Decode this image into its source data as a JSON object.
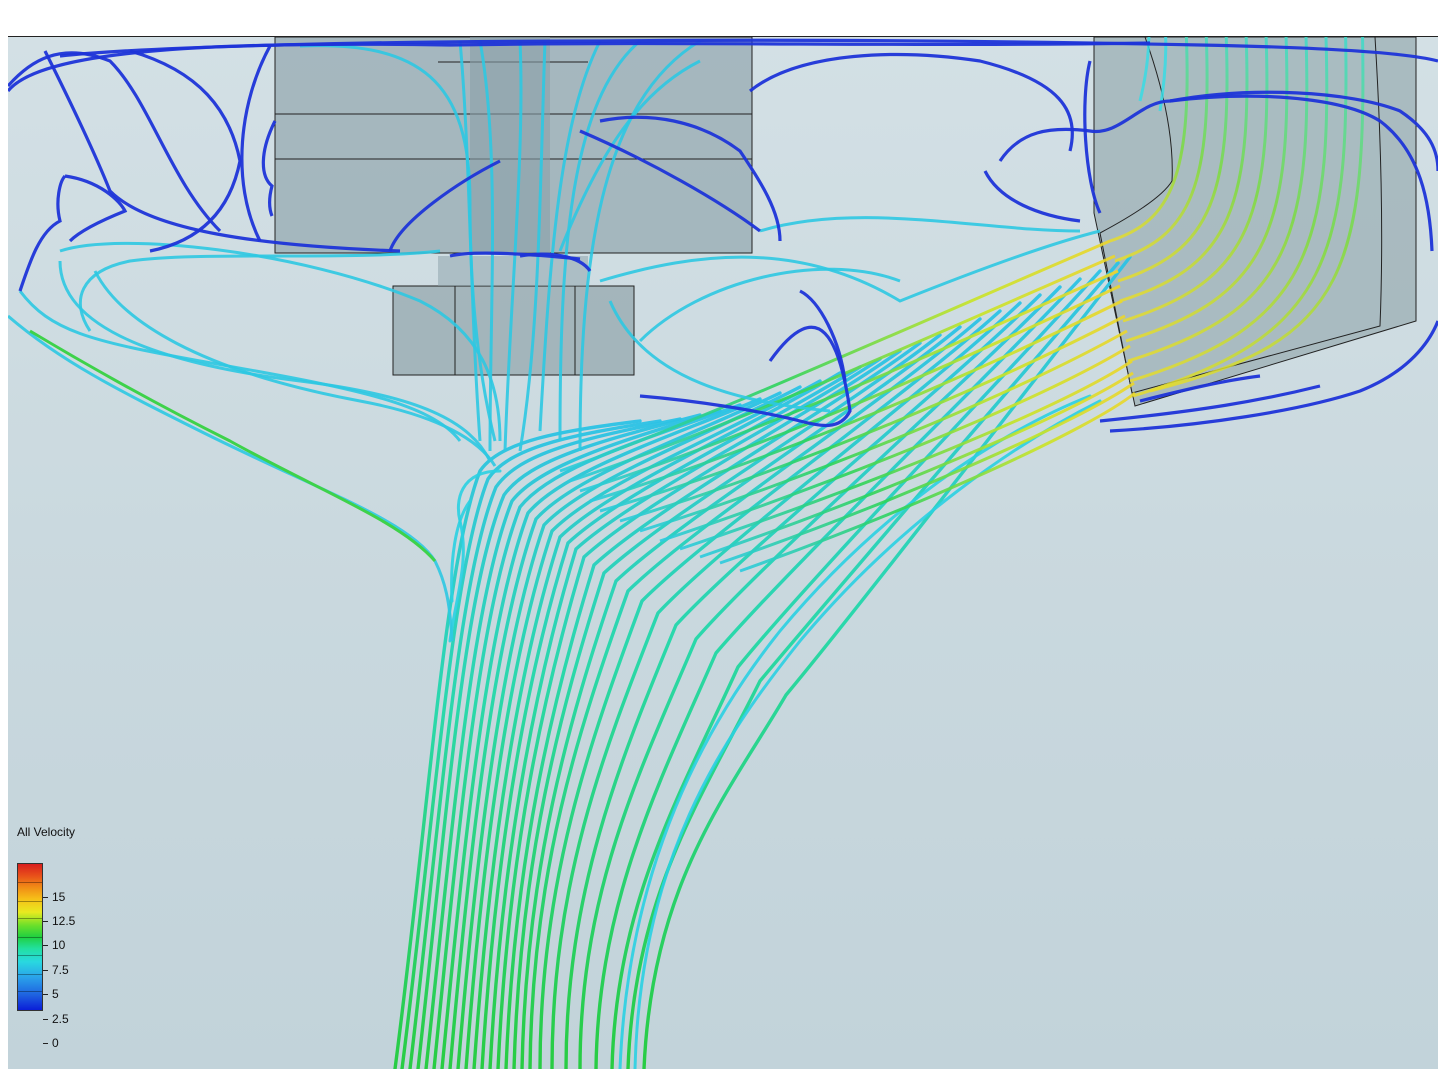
{
  "legend": {
    "title": "All Velocity",
    "ticks": [
      "15",
      "12.5",
      "10",
      "7.5",
      "5",
      "2.5",
      "0"
    ]
  },
  "colors": {
    "background": "#ccdbe0",
    "geometry": "#94a9b0",
    "low_velocity": "#1a2edc",
    "mid_velocity": "#28d4e4",
    "high_velocity": "#e8e622",
    "max_velocity": "#d81e1e"
  }
}
